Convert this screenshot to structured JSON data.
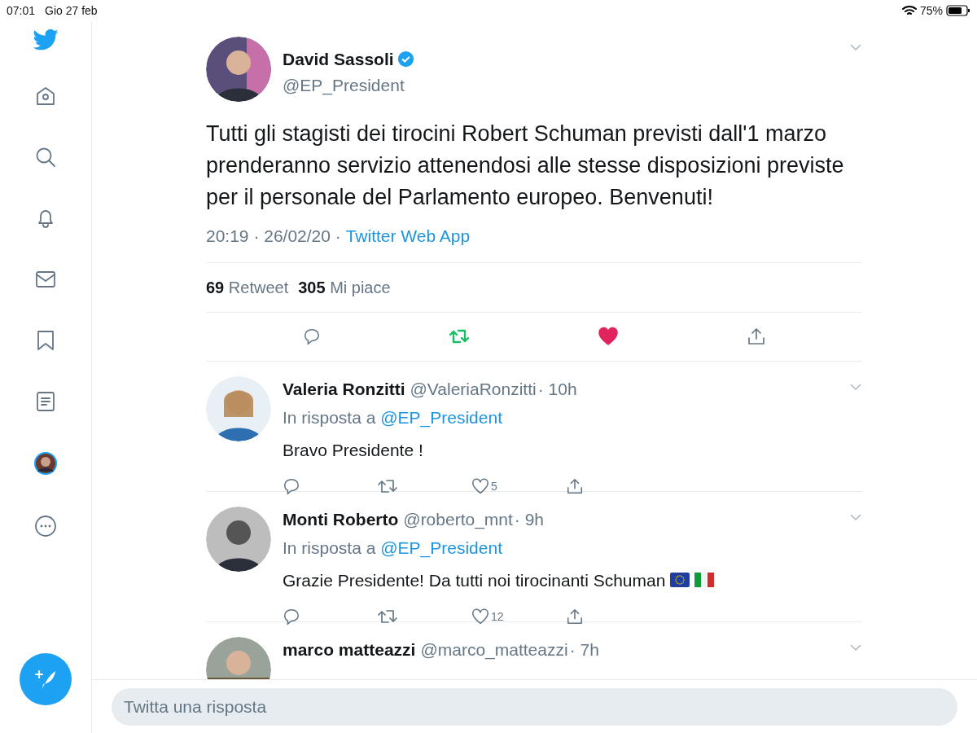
{
  "status_bar": {
    "time": "07:01",
    "date": "Gio 27 feb",
    "battery": "75%"
  },
  "sidebar": {
    "items": [
      {
        "kind": "home"
      },
      {
        "kind": "search"
      },
      {
        "kind": "bell"
      },
      {
        "kind": "mail"
      },
      {
        "kind": "bookmark"
      },
      {
        "kind": "list"
      },
      {
        "kind": "avatar"
      },
      {
        "kind": "more"
      }
    ]
  },
  "tweet": {
    "name": "David Sassoli",
    "verified": true,
    "handle": "@EP_President",
    "text": "Tutti gli stagisti dei tirocini Robert Schuman previsti dall'1 marzo prenderanno servizio attenendosi alle stesse disposizioni previste per il personale del Parlamento europeo. Benvenuti!",
    "time": "20:19 · 26/02/20 · ",
    "source": "Twitter Web App",
    "retweets": "69",
    "retweets_label": "Retweet",
    "likes": "305",
    "likes_label": "Mi piace",
    "retweeted": true,
    "liked": true
  },
  "replies": [
    {
      "name": "Valeria Ronzitti",
      "handle": "@ValeriaRonzitti",
      "age": "· 10h",
      "reply_to_label": "In risposta a",
      "reply_to": "@EP_President",
      "text": "Bravo Presidente !",
      "likes": "5",
      "liked": false
    },
    {
      "name": "Monti Roberto",
      "handle": "@roberto_mnt",
      "age": "· 9h",
      "reply_to_label": "In risposta a",
      "reply_to": "@EP_President",
      "text": "Grazie Presidente! Da tutti noi tirocinanti Schuman",
      "emoji": [
        {
          "kind": "eu-flag"
        },
        {
          "kind": "it-flag"
        }
      ],
      "likes": "12",
      "liked": false
    },
    {
      "name": "marco matteazzi",
      "handle": "@marco_matteazzi",
      "age": "· 7h"
    }
  ],
  "reply_box": {
    "placeholder": "Twitta una risposta"
  }
}
